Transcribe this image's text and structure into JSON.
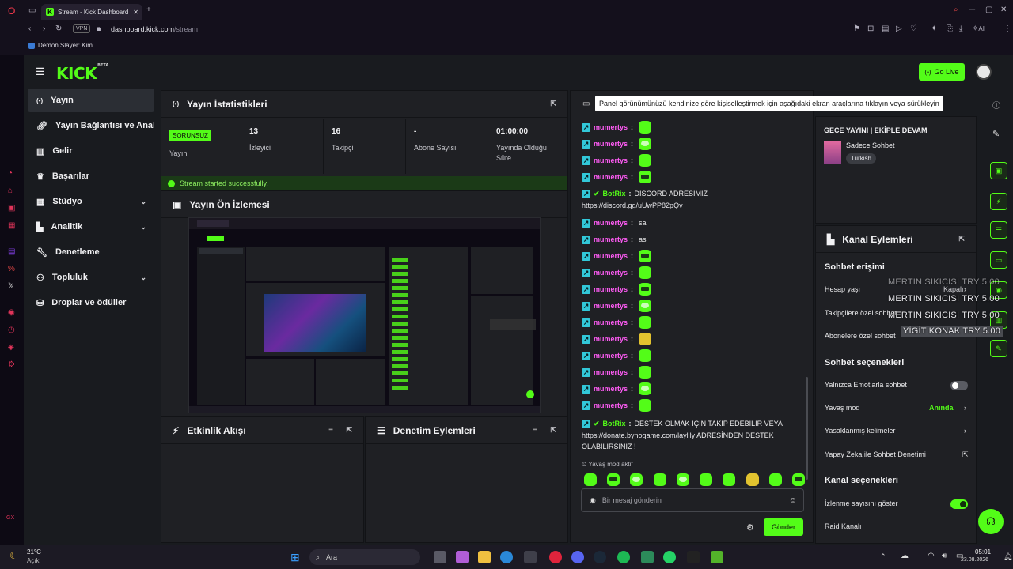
{
  "browser": {
    "tab_title": "Stream - Kick Dashboard",
    "url_host": "dashboard.kick.com",
    "url_path": "/stream",
    "vpn": "VPN",
    "ai_label": "AI",
    "bookmark": "Demon Slayer: Kim..."
  },
  "header": {
    "brand": "KICK",
    "brand_beta": "BETA",
    "go_live": "Go Live"
  },
  "sidebar": {
    "items": [
      {
        "label": "Yayın",
        "icon": "broadcast-icon"
      },
      {
        "label": "Yayın Bağlantısı ve Anahtar",
        "icon": "link-icon"
      },
      {
        "label": "Gelir",
        "icon": "revenue-icon"
      },
      {
        "label": "Başarılar",
        "icon": "trophy-icon"
      },
      {
        "label": "Stüdyo",
        "icon": "studio-icon"
      },
      {
        "label": "Analitik",
        "icon": "analytics-icon"
      },
      {
        "label": "Denetleme",
        "icon": "wrench-icon"
      },
      {
        "label": "Topluluk",
        "icon": "community-icon"
      },
      {
        "label": "Droplar ve ödüller",
        "icon": "drops-icon"
      }
    ]
  },
  "stats_panel": {
    "title": "Yayın İstatistikleri",
    "status_badge": "SORUNSUZ",
    "cells": [
      {
        "value": "",
        "label": "Yayın"
      },
      {
        "value": "13",
        "label": "İzleyici"
      },
      {
        "value": "16",
        "label": "Takipçi"
      },
      {
        "value": "-",
        "label": "Abone Sayısı"
      },
      {
        "value": "01:00:00",
        "label": "Yayında Olduğu Süre"
      }
    ],
    "success_msg": "Stream started successfully."
  },
  "preview_panel": {
    "title": "Yayın Ön İzlemesi"
  },
  "activity_panel": {
    "title": "Etkinlik Akışı"
  },
  "mod_panel": {
    "title": "Denetim Eylemleri"
  },
  "chat": {
    "tooltip": "Panel görünümünüzü kendinize göre kişiselleştirmek için aşağıdaki ekran araçlarına tıklayın veya sürükleyin",
    "user": "mumertys",
    "bot": "BotRix",
    "sa": "sa",
    "as": "as",
    "bot_msg1": "DİSCORD ADRESİMİZ",
    "bot_link1": "https://discord.gg/uUwPP82pQv",
    "bot_msg2_a": "DESTEK OLMAK İÇİN TAKİP EDEBİLİR VEYA",
    "bot_link2": "https://donate.bynogame.com/laylily",
    "bot_msg2_b": "ADRESİNDEN DESTEK OLABİLİRSİNİZ !",
    "slow_mode": "Yavaş mod aktif",
    "input_placeholder": "Bir mesaj gönderin",
    "send": "Gönder"
  },
  "stream_info": {
    "title": "GECE YAYINI | EKİPLE DEVAM",
    "category": "Sadece Sohbet",
    "tag": "Turkish"
  },
  "channel_actions": {
    "title": "Kanal Eylemleri",
    "chat_access": "Sohbet erişimi",
    "account_age": "Hesap yaşı",
    "account_age_value": "Kapalı",
    "followers_only": "Takipçilere özel sohbet",
    "subs_only": "Abonelere özel sohbet",
    "chat_options": "Sohbet seçenekleri",
    "emote_only": "Yalnızca Emotlarla sohbet",
    "slow_mode": "Yavaş mod",
    "slow_mode_value": "Anında",
    "banned_words": "Yasaklanmış kelimeler",
    "ai_mod": "Yapay Zeka ile Sohbet Denetimi",
    "channel_options": "Kanal seçenekleri",
    "show_viewers": "İzlenme sayısını göster",
    "raid": "Raid Kanalı"
  },
  "donations": [
    "MERTIN SIKICISI   TRY 5.00",
    "MERTIN SIKICISI   TRY 5.00",
    "MERTIN SIKICISI   TRY 5.00",
    "YİGİT KONAK   TRY 5.00"
  ],
  "taskbar": {
    "weather_temp": "21°C",
    "weather_text": "Açık",
    "search": "Ara",
    "time": "05:01",
    "date": "23.08.2026"
  },
  "colors": {
    "kick_green": "#53fc18",
    "panel": "#1f2024",
    "bg": "#191b1f"
  }
}
